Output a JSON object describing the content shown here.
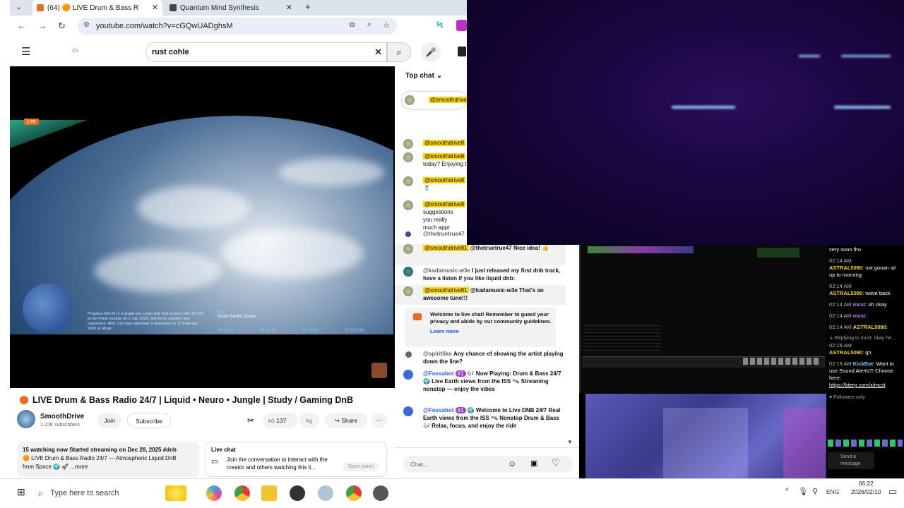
{
  "browser": {
    "tabs": [
      {
        "label": "(64) 🟠 LIVE Drum & Bass R",
        "active": true
      },
      {
        "label": "Quantum Mind Synthesis",
        "active": false
      }
    ],
    "new_tab": "+",
    "url": "youtube.com/watch?v=cGQwUADghsM"
  },
  "youtube": {
    "search_value": "rust cohle",
    "logo_text": "ZA",
    "video": {
      "live_label": "Live",
      "overlay_text": "Progress MS-31 is a single-use cargo ship that docked with the ISS at the Poisk module on 5 July 2025, delivering supplies and equipment. After 219 days attached, it undocked on 10 February 2026 at about",
      "location_label": "Now",
      "location": "South Pacific Ocean",
      "telemetry": [
        "04:22:30",
        "00:21:32",
        "00:18:58",
        "27,563.59"
      ]
    },
    "title": "LIVE Drum & Bass Radio 24/7 | Liquid • Neuro • Jungle | Study / Gaming DnB",
    "channel": {
      "name": "SmoothDrive",
      "subscribers": "1.22K subscribers"
    },
    "buttons": {
      "join": "Join",
      "subscribe": "Subscribe",
      "likes": "137",
      "share": "Share"
    },
    "description": {
      "line1": "15 watching now  Started streaming on Dec 28, 2025  #dnb",
      "line2": "🟠 LIVE Drum & Bass Radio 24/7 — Atmospheric Liquid DnB",
      "line3": "from Space 🌍 🚀  ...more"
    },
    "live_chat_box": {
      "title": "Live chat",
      "text": "Join the conversation to interact with the creator and others watching this li...",
      "open_panel": "Open panel"
    }
  },
  "chat": {
    "header": "Top chat",
    "pinned_user": "@smoothdrive81",
    "messages": [
      {
        "user": "@smoothdrive8",
        "text": ""
      },
      {
        "user": "@smoothdrive8",
        "text": "today? Enjoying t"
      },
      {
        "user": "@smoothdrive8",
        "text": "🥤"
      },
      {
        "user": "@smoothdrive8",
        "text": "suggestions you really much appr"
      },
      {
        "user": "@thetruetrue47",
        "text": ""
      },
      {
        "user": "@smoothdrive81",
        "text": "@thetruetrue47 Nice idea! 👍"
      },
      {
        "user": "@kadamusic-w3e",
        "text": "I just released my first dnb track, have a listen if you like liquid dnb:"
      },
      {
        "user": "@smoothdrive81",
        "text": "@kadamusic-w3e That's an awesome tune!!!"
      }
    ],
    "welcome": "Welcome to live chat! Remember to guard your privacy and abide by our community guidelines.",
    "learn_more": "Learn more",
    "messages2": [
      {
        "user": "@spiritlike",
        "text": "Any chance of showing the artist playing down the line?"
      },
      {
        "user": "@Fossabot",
        "badge": "#1",
        "text": "🎶 Now Playing: Drum & Bass 24/7 🌍 Live Earth views from the ISS 🛰️ Streaming nonstop — enjoy the vibes"
      },
      {
        "user": "@Fossabot",
        "badge": "#1",
        "text": "🌍 Welcome to Live DNB 24/7 Real Earth views from the ISS 🛰️ Nonstop Drum & Bass 🎶 Relax, focus, and enjoy the ride"
      }
    ],
    "input_placeholder": "Chat..."
  },
  "kick_chat": {
    "first": "very soon tho",
    "entries": [
      {
        "time": "02:14 AM",
        "user": "ASTRAL5090",
        "text": "not gonan sit up to morning"
      },
      {
        "time": "02:14 AM",
        "user": "ASTRAL5090",
        "text": "wave back"
      },
      {
        "time": "02:14 AM",
        "user": "mcst",
        "text": "oh okay"
      },
      {
        "time": "02:14 AM",
        "user": "mcst",
        "text": ""
      },
      {
        "time": "02:14 AM",
        "user": "ASTRAL5090",
        "text": ""
      }
    ],
    "reply": "↳ Replying to mcst: okay he...",
    "reply_time": "02:18 AM",
    "reply_user": "ASTRAL5090",
    "reply_text": "gn",
    "bot_time": "02:19 AM",
    "bot_user": "KickBot",
    "bot_text": "Want to use Sound Alerts?! Choose here:",
    "bot_link": "https://bterp.com/x/mcst",
    "followers_only": "♥ Followers only",
    "send": "Send a message"
  },
  "taskbar": {
    "search_placeholder": "Type here to search",
    "lang": "ENG",
    "time": "06:22",
    "date": "2026/02/10"
  }
}
